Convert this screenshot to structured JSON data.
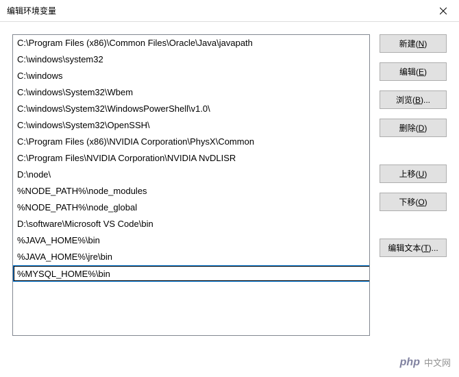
{
  "window": {
    "title": "编辑环境变量"
  },
  "list": {
    "items": [
      "C:\\Program Files (x86)\\Common Files\\Oracle\\Java\\javapath",
      "C:\\windows\\system32",
      "C:\\windows",
      "C:\\windows\\System32\\Wbem",
      "C:\\windows\\System32\\WindowsPowerShell\\v1.0\\",
      "C:\\windows\\System32\\OpenSSH\\",
      "C:\\Program Files (x86)\\NVIDIA Corporation\\PhysX\\Common",
      "C:\\Program Files\\NVIDIA Corporation\\NVIDIA NvDLISR",
      "D:\\node\\",
      "%NODE_PATH%\\node_modules",
      "%NODE_PATH%\\node_global",
      "D:\\software\\Microsoft VS Code\\bin",
      "%JAVA_HOME%\\bin",
      "%JAVA_HOME%\\jre\\bin"
    ],
    "editing_value": "%MYSQL_HOME%\\bin"
  },
  "buttons": {
    "new": {
      "label": "新建(",
      "key": "N",
      "suffix": ")"
    },
    "edit": {
      "label": "编辑(",
      "key": "E",
      "suffix": ")"
    },
    "browse": {
      "label": "浏览(",
      "key": "B",
      "suffix": ")..."
    },
    "delete": {
      "label": "删除(",
      "key": "D",
      "suffix": ")"
    },
    "moveup": {
      "label": "上移(",
      "key": "U",
      "suffix": ")"
    },
    "movedown": {
      "label": "下移(",
      "key": "O",
      "suffix": ")"
    },
    "edittext": {
      "label": "编辑文本(",
      "key": "T",
      "suffix": ")..."
    }
  },
  "watermark": {
    "logo": "php",
    "text": "中文网"
  }
}
